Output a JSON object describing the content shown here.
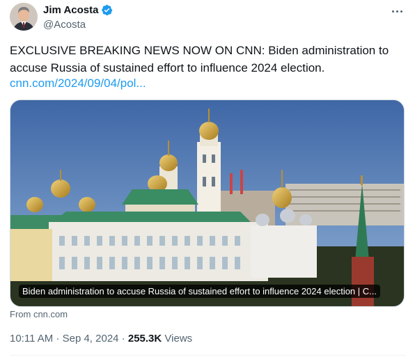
{
  "author": {
    "name": "Jim Acosta",
    "handle": "@Acosta",
    "verified": true,
    "avatar_icon": "profile-photo"
  },
  "more_icon": "more-dots-icon",
  "tweet": {
    "text": "EXCLUSIVE BREAKING NEWS NOW ON CNN: Biden administration to accuse Russia of sustained effort to influence 2024 election.",
    "link": "cnn.com/2024/09/04/pol..."
  },
  "card": {
    "caption": "Biden administration to accuse Russia of sustained effort to influence 2024 election | C...",
    "source": "From cnn.com",
    "image_subject": "Kremlin skyline photo"
  },
  "meta": {
    "time": "10:11 AM",
    "separator": "·",
    "date": "Sep 4, 2024",
    "views_count": "255.3K",
    "views_label": "Views"
  },
  "colors": {
    "text": "#0f1419",
    "secondary": "#536471",
    "link": "#1d9bf0",
    "verified": "#1d9bf0"
  }
}
